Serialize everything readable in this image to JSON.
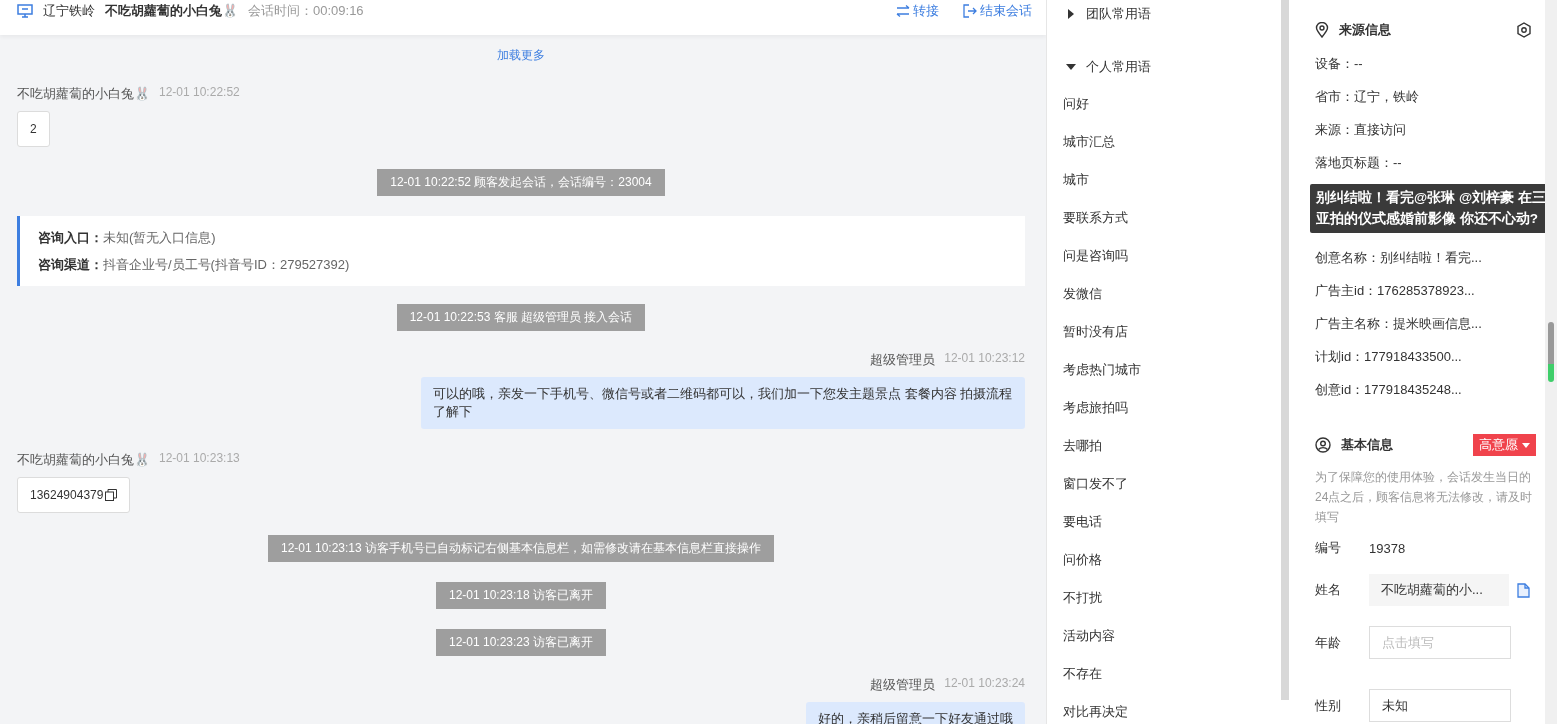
{
  "header": {
    "location": "辽宁铁岭",
    "visitor": "不吃胡蘿蔔的小白兔🐰",
    "duration": "会话时间：00:09:16",
    "actions": [
      {
        "kind": "transfer",
        "label": "转接"
      },
      {
        "kind": "end",
        "label": "结束会话"
      }
    ]
  },
  "chat": {
    "load_more": "加载更多",
    "messages": [
      {
        "kind": "customer",
        "sender": "不吃胡蘿蔔的小白兔🐰",
        "time": "12-01 10:22:52",
        "text": "2"
      },
      {
        "kind": "system",
        "text": "12-01 10:22:52 顾客发起会话，会话编号：23004"
      },
      {
        "kind": "info",
        "lines": [
          {
            "label": "咨询入口：",
            "value": "未知(暂无入口信息)"
          },
          {
            "label": "咨询渠道：",
            "value": "抖音企业号/员工号(抖音号ID：279527392)"
          }
        ]
      },
      {
        "kind": "system",
        "text": "12-01 10:22:53 客服 超级管理员 接入会话"
      },
      {
        "kind": "agent",
        "sender": "超级管理员",
        "time": "12-01 10:23:12",
        "text": "可以的哦，亲发一下手机号、微信号或者二维码都可以，我们加一下您发主题景点 套餐内容 拍摄流程了解下"
      },
      {
        "kind": "customer",
        "sender": "不吃胡蘿蔔的小白兔🐰",
        "time": "12-01 10:23:13",
        "text": "13624904379",
        "copy": true
      },
      {
        "kind": "system",
        "text": "12-01 10:23:13 访客手机号已自动标记右侧基本信息栏，如需修改请在基本信息栏直接操作"
      },
      {
        "kind": "system",
        "text": "12-01 10:23:18 访客已离开"
      },
      {
        "kind": "system",
        "text": "12-01 10:23:23 访客已离开"
      },
      {
        "kind": "agent",
        "sender": "超级管理员",
        "time": "12-01 10:23:24",
        "text": "好的，亲稍后留意一下好友通过哦"
      }
    ]
  },
  "phrases": [
    {
      "label": "团队常用语",
      "expanded": false
    },
    {
      "label": "个人常用语",
      "expanded": true,
      "children": [
        "问好",
        "城市汇总",
        "城市",
        "要联系方式",
        "问是咨询吗",
        "发微信",
        "暂时没有店",
        "考虑热门城市",
        "考虑旅拍吗",
        "去哪拍",
        "窗口发不了",
        "要电话",
        "问价格",
        "不打扰",
        "活动内容",
        "不存在",
        "对比再决定"
      ]
    }
  ],
  "source": {
    "title": "来源信息",
    "rows": [
      "设备：--",
      "省市：辽宁，铁岭",
      "来源：直接访问",
      "落地页标题：--"
    ],
    "tooltip": "别纠结啦！看完@张琳 @刘梓豪 在三亚拍的仪式感婚前影像 你还不心动?",
    "rows_after": [
      "创意名称：别纠结啦！看完...",
      "广告主id：176285378923...",
      "广告主名称：提米映画信息...",
      "计划id：177918433500...",
      "创意id：177918435248..."
    ]
  },
  "basic": {
    "title": "基本信息",
    "badge": "高意愿",
    "notice": "为了保障您的使用体验，会话发生当日的24点之后，顾客信息将无法修改，请及时填写",
    "fields": [
      {
        "kind": "text",
        "label": "编号",
        "value": "19378"
      },
      {
        "kind": "filled",
        "label": "姓名",
        "value": "不吃胡蘿蔔的小...",
        "copy": true
      },
      {
        "kind": "input",
        "label": "年龄",
        "placeholder": "点击填写"
      },
      {
        "kind": "input",
        "label": "性别",
        "value": "未知"
      }
    ]
  }
}
